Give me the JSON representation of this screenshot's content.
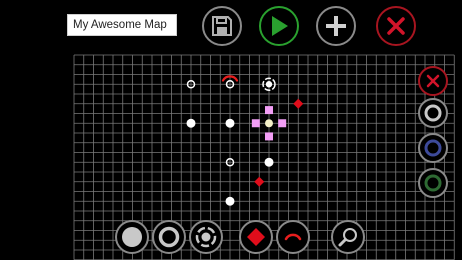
{
  "map_name": "My Awesome Map",
  "colors": {
    "background": "#000000",
    "grid": "#7a7a7a",
    "button_ring": "#8a8a8a",
    "play_green": "#2aa12f",
    "close_red": "#d2142a",
    "node_white": "#ffffff",
    "crosshair_pink": "#f29ef5",
    "gem_red": "#e00d1b",
    "arc_red": "#e81e1e",
    "palette_gray": "#9a9a9a",
    "palette_blue": "#3d4a9a",
    "palette_green": "#2e6a33"
  },
  "toolbar": {
    "save": "save-icon",
    "play": "play-icon",
    "add": "plus-icon",
    "close": "close-icon"
  },
  "palette": [
    "close-icon",
    "ring-gray-icon",
    "ring-blue-icon",
    "ring-green-icon"
  ],
  "tools": [
    "filled-circle-tool",
    "ring-tool",
    "dashed-ring-tool",
    "diamond-tool",
    "arc-tool",
    "zoom-icon"
  ],
  "map": {
    "grid_columns": 39,
    "grid_rows": 21,
    "nodes": [
      {
        "type": "ring",
        "col": 12,
        "row": 3
      },
      {
        "type": "ring",
        "col": 16,
        "row": 3
      },
      {
        "type": "target",
        "col": 20,
        "row": 3
      },
      {
        "type": "dot",
        "col": 12,
        "row": 7
      },
      {
        "type": "dot",
        "col": 16,
        "row": 7
      },
      {
        "type": "ring",
        "col": 16,
        "row": 11
      },
      {
        "type": "dot",
        "col": 20,
        "row": 11
      },
      {
        "type": "dot",
        "col": 16,
        "row": 15
      }
    ],
    "crosshair": {
      "col": 20,
      "row": 7
    },
    "gems": [
      {
        "col": 23,
        "row": 5
      },
      {
        "col": 19,
        "row": 13
      }
    ],
    "arc": {
      "col": 16,
      "row": 2
    }
  }
}
